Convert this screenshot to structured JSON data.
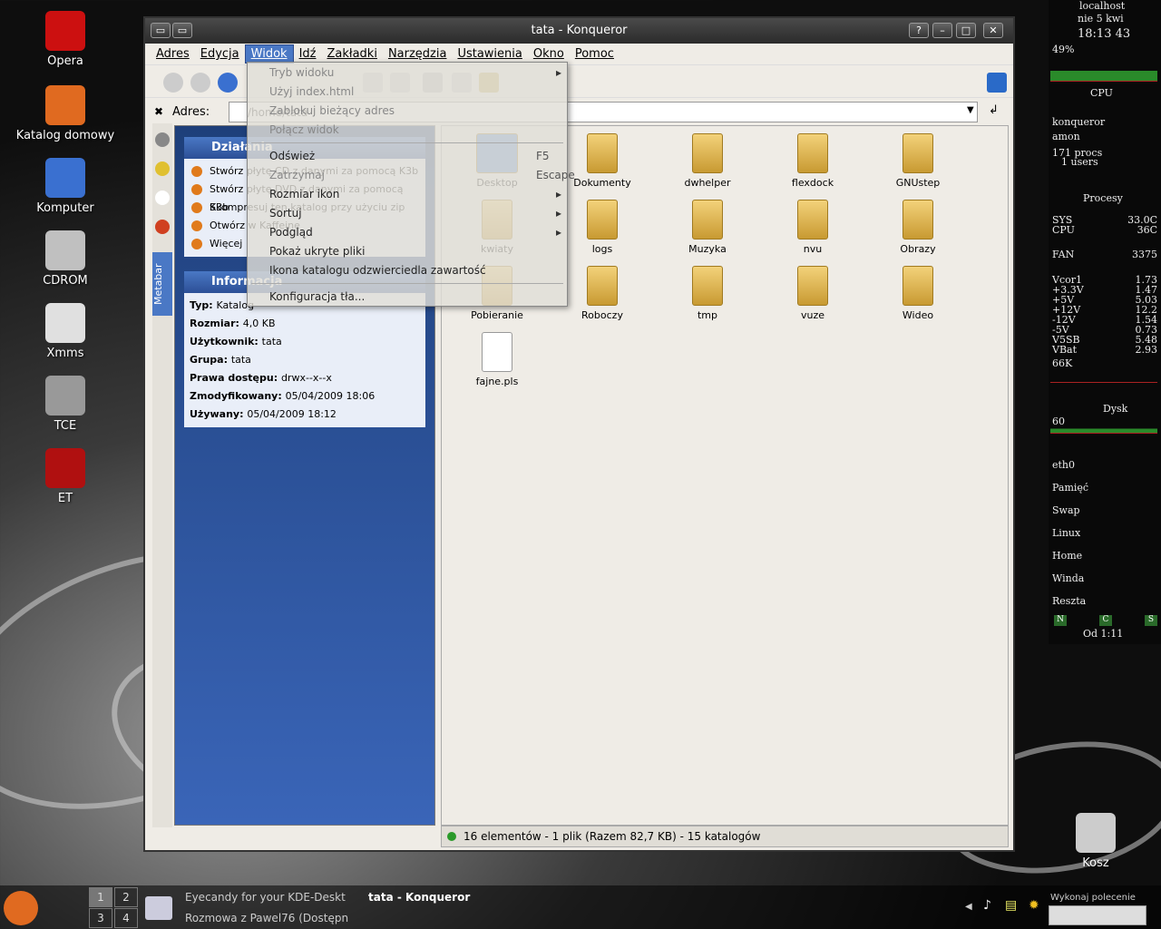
{
  "desktop_icons": [
    {
      "label": "Opera",
      "name": "opera-icon",
      "color": "#cc1010"
    },
    {
      "label": "Katalog domowy",
      "name": "home-folder-icon",
      "color": "#e06a20"
    },
    {
      "label": "Komputer",
      "name": "computer-icon",
      "color": "#3a70d0"
    },
    {
      "label": "CDROM",
      "name": "cdrom-icon",
      "color": "#c0c0c0"
    },
    {
      "label": "Xmms",
      "name": "xmms-icon",
      "color": "#e0e0e0"
    },
    {
      "label": "TCE",
      "name": "tce-icon",
      "color": "#999"
    },
    {
      "label": "ET",
      "name": "et-icon",
      "color": "#b01010"
    },
    {
      "label": "Kosz",
      "name": "trash-icon",
      "color": "#ccc"
    }
  ],
  "window": {
    "title": "tata - Konqueror",
    "menu": [
      "Adres",
      "Edycja",
      "Widok",
      "Idź",
      "Zakładki",
      "Narzędzia",
      "Ustawienia",
      "Okno",
      "Pomoc"
    ],
    "address_label": "Adres:",
    "address_value": "/home/tata",
    "sidebar_tab": "Metabar"
  },
  "metabar": {
    "actions_header": "Działania",
    "actions": [
      "Stwórz płytę CD z danymi za pomocą K3b",
      "Stwórz płytę DVD z danymi za pomocą K3b",
      "Skompresuj ten katalog przy użyciu zip",
      "Otwórz w Kaffeine",
      "Więcej"
    ],
    "info_header": "Informacja",
    "info": [
      {
        "k": "Typ:",
        "v": "Katalog"
      },
      {
        "k": "Rozmiar:",
        "v": "4,0 KB"
      },
      {
        "k": "Użytkownik:",
        "v": "tata"
      },
      {
        "k": "Grupa:",
        "v": "tata"
      },
      {
        "k": "Prawa dostępu:",
        "v": "drwx--x--x"
      },
      {
        "k": "Zmodyfikowany:",
        "v": "05/04/2009 18:06"
      },
      {
        "k": "Używany:",
        "v": "05/04/2009 18:12"
      }
    ]
  },
  "files": [
    "Desktop",
    "Dokumenty",
    "dwhelper",
    "flexdock",
    "GNUstep",
    "kwiaty",
    "logs",
    "Muzyka",
    "nvu",
    "Obrazy",
    "Pobieranie",
    "Roboczy",
    "tmp",
    "vuze",
    "Wideo",
    "fajne.pls"
  ],
  "status": "16 elementów - 1 plik (Razem 82,7 KB) - 15 katalogów",
  "dropdown": {
    "items": [
      {
        "label": "Tryb widoku",
        "dis": true,
        "arrow": true
      },
      {
        "label": "Użyj index.html",
        "dis": true
      },
      {
        "label": "Zablokuj bieżący adres",
        "dis": true
      },
      {
        "label": "Połącz widok",
        "dis": true
      },
      {
        "label": "Odśwież",
        "shortcut": "F5"
      },
      {
        "label": "Zatrzymaj",
        "dis": true,
        "shortcut": "Escape"
      },
      {
        "label": "Rozmiar ikon",
        "arrow": true
      },
      {
        "label": "Sortuj",
        "arrow": true
      },
      {
        "label": "Podgląd",
        "arrow": true
      },
      {
        "label": "Pokaż ukryte pliki"
      },
      {
        "label": "Ikona katalogu odzwierciedla zawartość"
      },
      {
        "label": "Konfiguracja tła..."
      }
    ]
  },
  "conky": {
    "host": "localhost",
    "date": "nie  5 kwi",
    "time": "18:13 43",
    "cpu_pct": "49%",
    "cpu_label": "CPU",
    "procs": "171 procs",
    "users": "1 users",
    "top": [
      "konqueror",
      "amon"
    ],
    "section_procesy": "Procesy",
    "sensors": [
      {
        "k": "SYS",
        "v": "33.0C"
      },
      {
        "k": "CPU",
        "v": "36C"
      },
      {
        "k": "FAN",
        "v": "3375"
      },
      {
        "k": "Vcor1",
        "v": "1.73"
      },
      {
        "k": "+3.3V",
        "v": "1.47"
      },
      {
        "k": "+5V",
        "v": "5.03"
      },
      {
        "k": "+12V",
        "v": "12.2"
      },
      {
        "k": "-12V",
        "v": "1.54"
      },
      {
        "k": "-5V",
        "v": "0.73"
      },
      {
        "k": "V5SB",
        "v": "5.48"
      },
      {
        "k": "VBat",
        "v": "2.93"
      }
    ],
    "net": "66K",
    "disk_label": "Dysk",
    "disk_val": "60",
    "rows": [
      "eth0",
      "Pamięć",
      "Swap",
      "Linux",
      "Home",
      "Winda",
      "Reszta"
    ],
    "uptime": "Od  1:11",
    "nav": [
      "N",
      "C",
      "S"
    ]
  },
  "taskbar": {
    "desktops": [
      "1",
      "2",
      "3",
      "4"
    ],
    "tasks": [
      "Eyecandy for your KDE-Deskt",
      "tata - Konqueror",
      "Rozmowa z Pawel76 (Dostępn"
    ],
    "cmd_label": "Wykonaj polecenie"
  }
}
